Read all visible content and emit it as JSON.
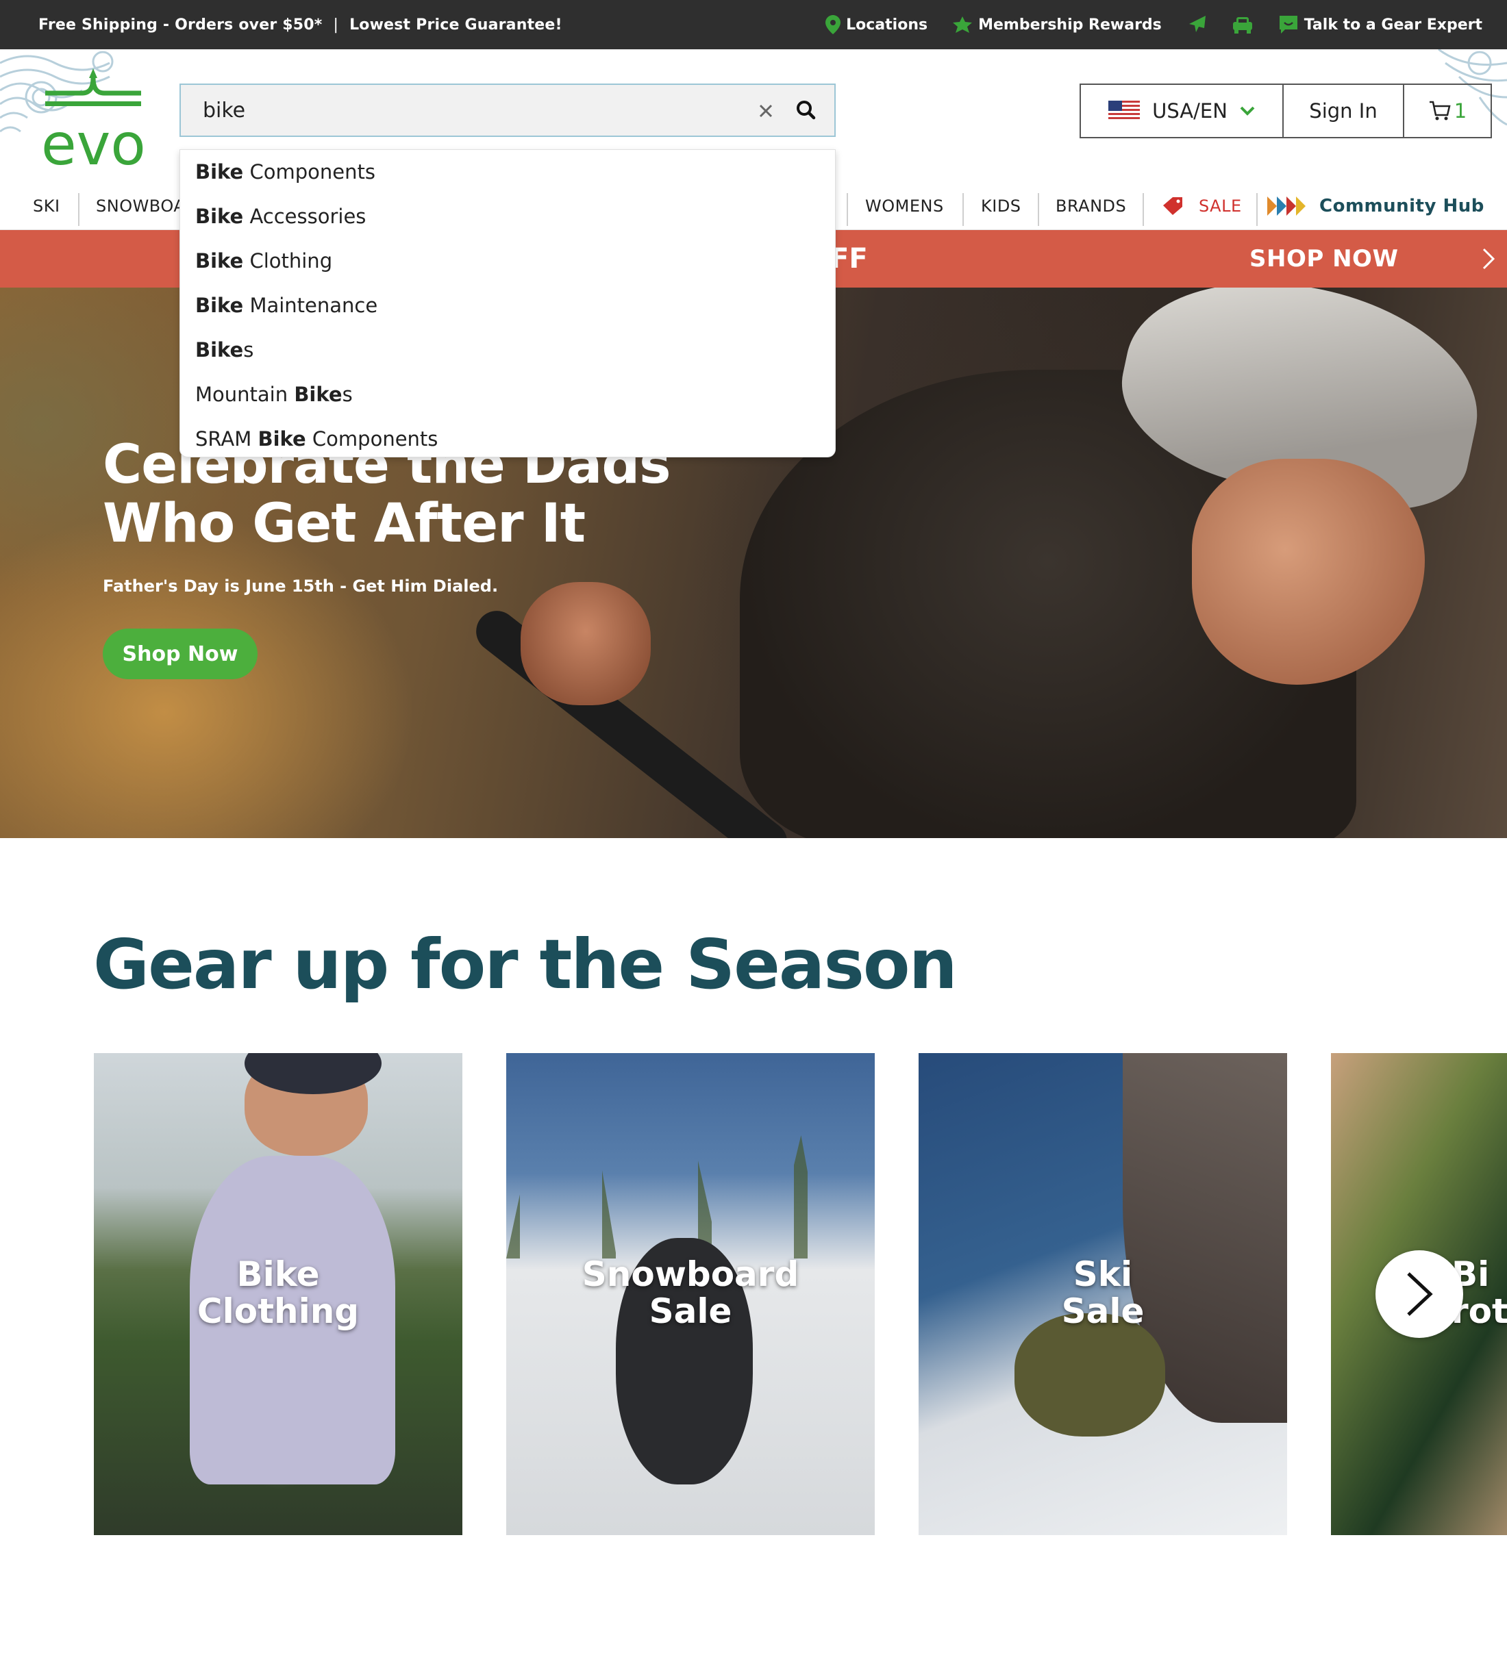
{
  "topbar": {
    "promo_shipping": "Free Shipping - Orders over $50*",
    "promo_separator": "|",
    "promo_price": "Lowest Price Guarantee!",
    "locations": "Locations",
    "membership": "Membership Rewards",
    "talk_expert": "Talk to a Gear Expert",
    "icons": [
      "map-pin-icon",
      "leaf-icon",
      "plane-icon",
      "car-icon",
      "chat-icon"
    ]
  },
  "header": {
    "logo_text": "evo",
    "search": {
      "value": "bike"
    },
    "locale": "USA/EN",
    "sign_in": "Sign In",
    "cart_count": "1"
  },
  "nav": {
    "items": [
      "SKI",
      "SNOWBOA",
      "WOMENS",
      "KIDS",
      "BRANDS",
      "SALE",
      "Community Hub"
    ]
  },
  "suggestions": [
    {
      "bold": "Bike",
      "rest": " Components",
      "prefix": ""
    },
    {
      "bold": "Bike",
      "rest": " Accessories",
      "prefix": ""
    },
    {
      "bold": "Bike",
      "rest": " Clothing",
      "prefix": ""
    },
    {
      "bold": "Bike",
      "rest": " Maintenance",
      "prefix": ""
    },
    {
      "bold": "Bike",
      "rest": "s",
      "prefix": ""
    },
    {
      "prefix": "Mountain ",
      "bold": "Bike",
      "rest": "s"
    },
    {
      "prefix": "SRAM ",
      "bold": "Bike",
      "rest": " Components"
    }
  ],
  "sale_banner": {
    "partial": "FF",
    "shop_now": "SHOP NOW"
  },
  "hero": {
    "title": "Celebrate the Dads Who Get After It",
    "subtitle": "Father's Day is June 15th - Get Him Dialed.",
    "cta": "Shop Now"
  },
  "section": {
    "title": "Gear up for the Season",
    "cards": [
      {
        "line1": "Bike",
        "line2": "Clothing"
      },
      {
        "line1": "Snowboard",
        "line2": "Sale"
      },
      {
        "line1": "Ski",
        "line2": "Sale"
      },
      {
        "line1": "Bi",
        "line2": "rote"
      }
    ]
  },
  "colors": {
    "brand_green": "#3aa53a",
    "sale_red": "#d45b47",
    "heading_teal": "#1c4e5a",
    "topbar": "#2f2f2f",
    "hub_teal": "#1c4e5a"
  }
}
